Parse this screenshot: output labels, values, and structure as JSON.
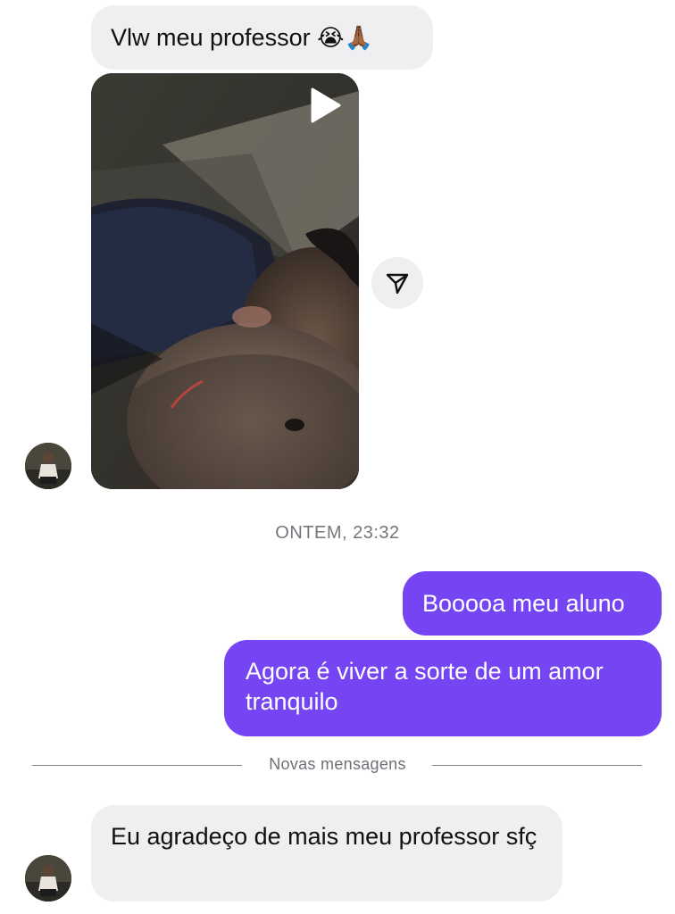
{
  "messages": {
    "first_incoming": "Vlw meu professor",
    "first_incoming_emoji": "😭🙏🏾",
    "timestamp": "ONTEM, 23:32",
    "out_1": "Booooa meu aluno",
    "out_2": "Agora é viver a sorte de um amor tranquilo",
    "divider": "Novas mensagens",
    "last_incoming": "Eu agradeço de mais meu professor sfç"
  },
  "icons": {
    "play": "play-icon",
    "share": "paper-plane-icon"
  },
  "colors": {
    "outgoing_bubble": "#7545f4",
    "incoming_bubble": "#efeff1",
    "background": "#ffffff"
  }
}
